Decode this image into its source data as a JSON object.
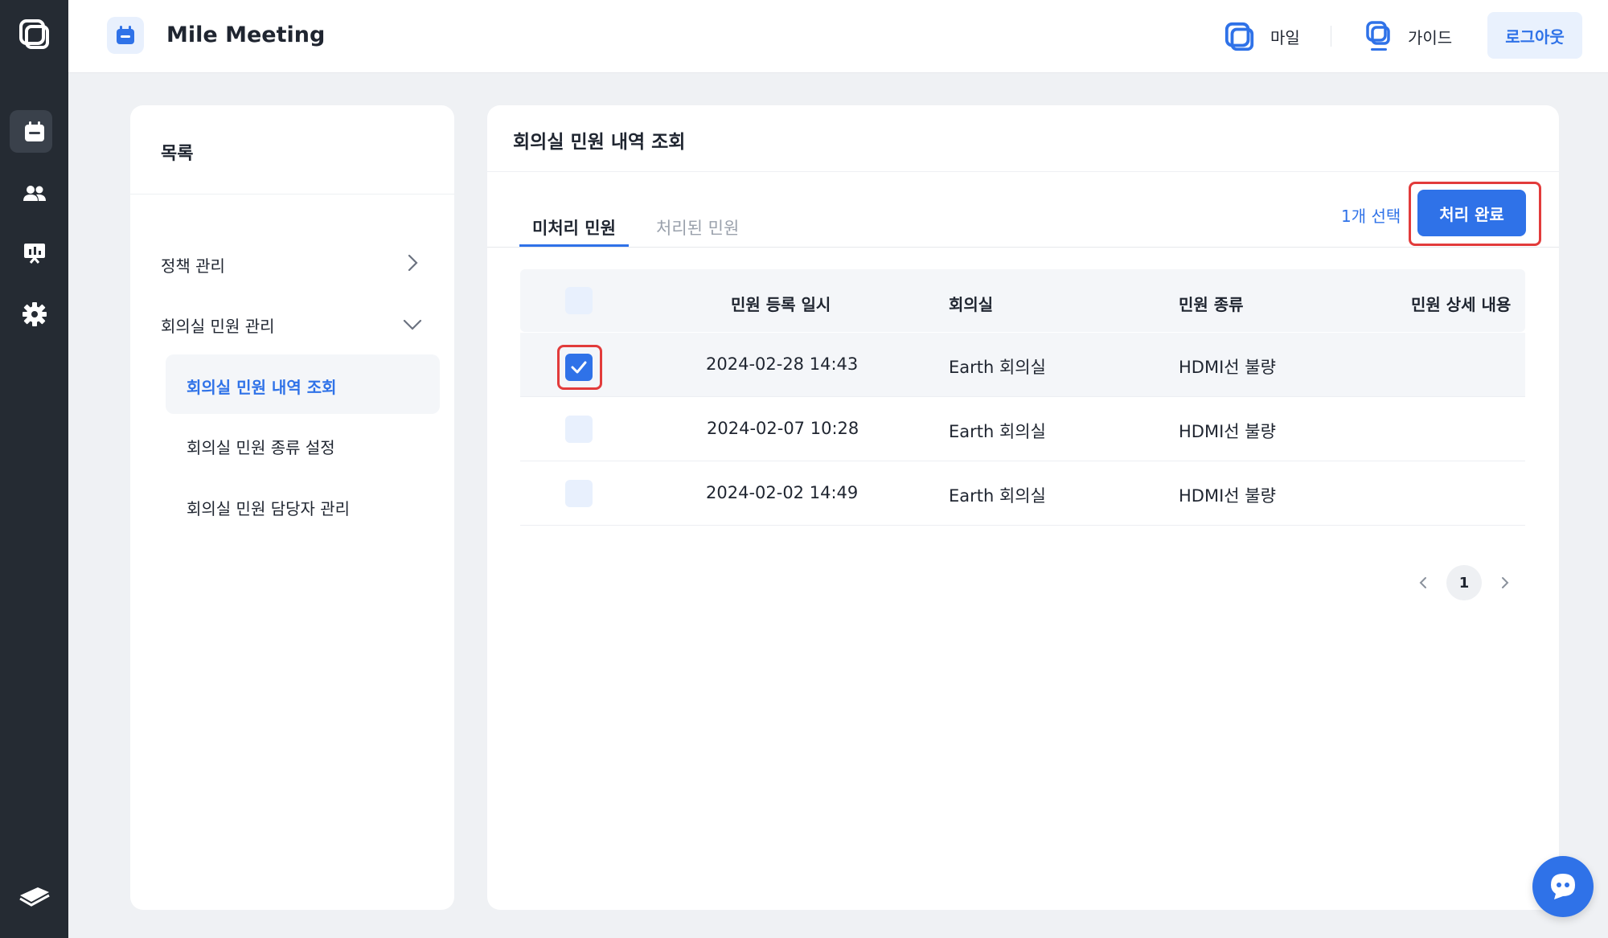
{
  "header": {
    "app_title": "Mile Meeting",
    "mile_label": "마일",
    "guide_label": "가이드",
    "logout_label": "로그아웃"
  },
  "side": {
    "title": "목록",
    "menu": [
      {
        "label": "정책 관리",
        "expanded": false
      },
      {
        "label": "회의실 민원 관리",
        "expanded": true
      }
    ],
    "submenu": [
      {
        "label": "회의실 민원 내역 조회",
        "active": true
      },
      {
        "label": "회의실 민원 종류 설정",
        "active": false
      },
      {
        "label": "회의실 민원 담당자 관리",
        "active": false
      }
    ]
  },
  "main": {
    "title": "회의실 민원 내역 조회",
    "tabs": [
      {
        "label": "미처리 민원",
        "active": true
      },
      {
        "label": "처리된 민원",
        "active": false
      }
    ],
    "selected_count": "1개 선택",
    "complete_button": "처리 완료",
    "columns": [
      "민원 등록 일시",
      "회의실",
      "민원 종류",
      "민원 상세 내용"
    ],
    "rows": [
      {
        "datetime": "2024-02-28 14:43",
        "room": "Earth 회의실",
        "type": "HDMI선 불량",
        "detail": "",
        "checked": true
      },
      {
        "datetime": "2024-02-07 10:28",
        "room": "Earth 회의실",
        "type": "HDMI선 불량",
        "detail": "",
        "checked": false
      },
      {
        "datetime": "2024-02-02 14:49",
        "room": "Earth 회의실",
        "type": "HDMI선 불량",
        "detail": "",
        "checked": false
      }
    ],
    "pagination": {
      "current": "1"
    }
  },
  "colors": {
    "accent": "#2f72e8",
    "rail": "#252b33",
    "highlight": "#e23b3b"
  }
}
